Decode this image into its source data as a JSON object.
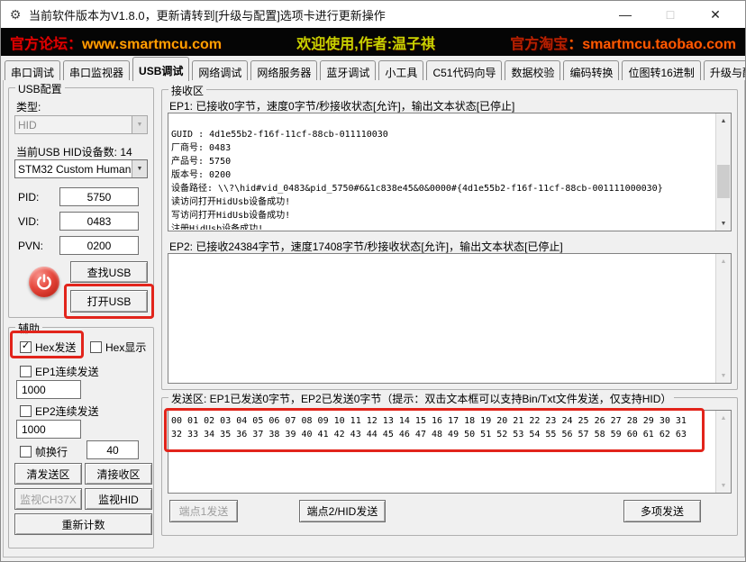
{
  "window": {
    "title": "当前软件版本为V1.8.0，更新请转到[升级与配置]选项卡进行更新操作",
    "controls": {
      "minimize": "—",
      "maximize": "□",
      "close": "✕"
    }
  },
  "banner": {
    "forum_label": "官方论坛：",
    "forum_url": "www.smartmcu.com",
    "welcome": "欢迎使用,作者:温子祺",
    "taobao_label": "官方淘宝",
    "taobao_url": "：smartmcu.taobao.com",
    "colors": {
      "forum_label": "#e00000",
      "forum_url": "#ffa000",
      "welcome": "#c8d400",
      "taobao_label": "#b72000",
      "taobao_url": "#ff5a00",
      "background": "#050505"
    }
  },
  "tabs": [
    "串口调试",
    "串口监视器",
    "USB调试",
    "网络调试",
    "网络服务器",
    "蓝牙调试",
    "小工具",
    "C51代码向导",
    "数据校验",
    "编码转换",
    "位图转16进制",
    "升级与配置"
  ],
  "active_tab": "USB调试",
  "usb_config": {
    "group_title": "USB配置",
    "type_label": "类型:",
    "type_value": "HID",
    "device_count_label": "当前USB HID设备数: 14",
    "device_select_value": "STM32 Custom Human",
    "pid_label": "PID:",
    "pid_value": "5750",
    "vid_label": "VID:",
    "vid_value": "0483",
    "pvn_label": "PVN:",
    "pvn_value": "0200",
    "find_usb_button": "查找USB",
    "open_usb_button": "打开USB"
  },
  "aux": {
    "group_title": "辅助",
    "hex_send_label": "Hex发送",
    "hex_send_checked": true,
    "hex_display_label": "Hex显示",
    "hex_display_checked": false,
    "ep1_cont_label": "EP1连续发送",
    "ep1_cont_checked": false,
    "ep1_interval": "1000",
    "ep2_cont_label": "EP2连续发送",
    "ep2_cont_checked": false,
    "ep2_interval": "1000",
    "frame_newline_label": "帧换行",
    "frame_newline_checked": false,
    "frame_newline_value": "40",
    "clear_send_button": "清发送区",
    "clear_recv_button": "清接收区",
    "monitor_ch37x_button": "监视CH37X",
    "monitor_hid_button": "监视HID",
    "recount_button": "重新计数"
  },
  "receive": {
    "group_title": "接收区",
    "ep1_status": "EP1: 已接收0字节，速度0字节/秒接收状态[允许]，输出文本状态[已停止]",
    "ep1_text": "\nGUID : 4d1e55b2-f16f-11cf-88cb-011110030\n厂商号: 0483\n产品号: 5750\n版本号: 0200\n设备路径: \\\\?\\hid#vid_0483&pid_5750#6&1c838e45&0&0000#{4d1e55b2-f16f-11cf-88cb-001111000030}\n读访问打开HidUsb设备成功!\n写访问打开HidUsb设备成功!\n注册HidUsb设备成功!",
    "ep2_status": "EP2: 已接收24384字节，速度17408字节/秒接收状态[允许]，输出文本状态[已停止]",
    "ep2_text": ""
  },
  "send": {
    "group_title": "发送区: EP1已发送0字节，EP2已发送0字节（提示：双击文本框可以支持Bin/Txt文件发送，仅支持HID）",
    "send_text": "00 01 02 03 04 05 06 07 08 09 10 11 12 13 14 15 16 17 18 19 20 21 22 23 24 25 26 27 28 29 30 31\n32 33 34 35 36 37 38 39 40 41 42 43 44 45 46 47 48 49 50 51 52 53 54 55 56 57 58 59 60 61 62 63",
    "ep1_send_button": "端点1发送",
    "ep2_send_button": "端点2/HID发送",
    "multi_send_button": "多项发送"
  },
  "icons": {
    "app": "⚙",
    "dropdown_arrow": "▼",
    "arrow_up": "▲",
    "arrow_down": "▼",
    "checkmark": "✓"
  },
  "annotation_color": "#e2241b"
}
